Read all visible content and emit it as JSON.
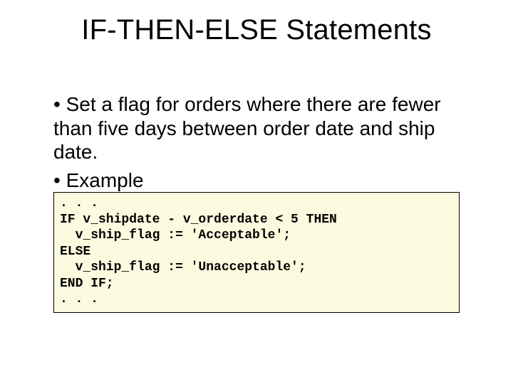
{
  "title": "IF-THEN-ELSE Statements",
  "bullets": {
    "b1": "• Set a flag for orders where there are fewer than five days between order date and ship date.",
    "b2": "• Example"
  },
  "code": {
    "l1": ". . .",
    "l2": "IF v_shipdate - v_orderdate < 5 THEN",
    "l3": "  v_ship_flag := 'Acceptable';",
    "l4": "ELSE",
    "l5": "  v_ship_flag := 'Unacceptable';",
    "l6": "END IF;",
    "l7": ". . ."
  }
}
